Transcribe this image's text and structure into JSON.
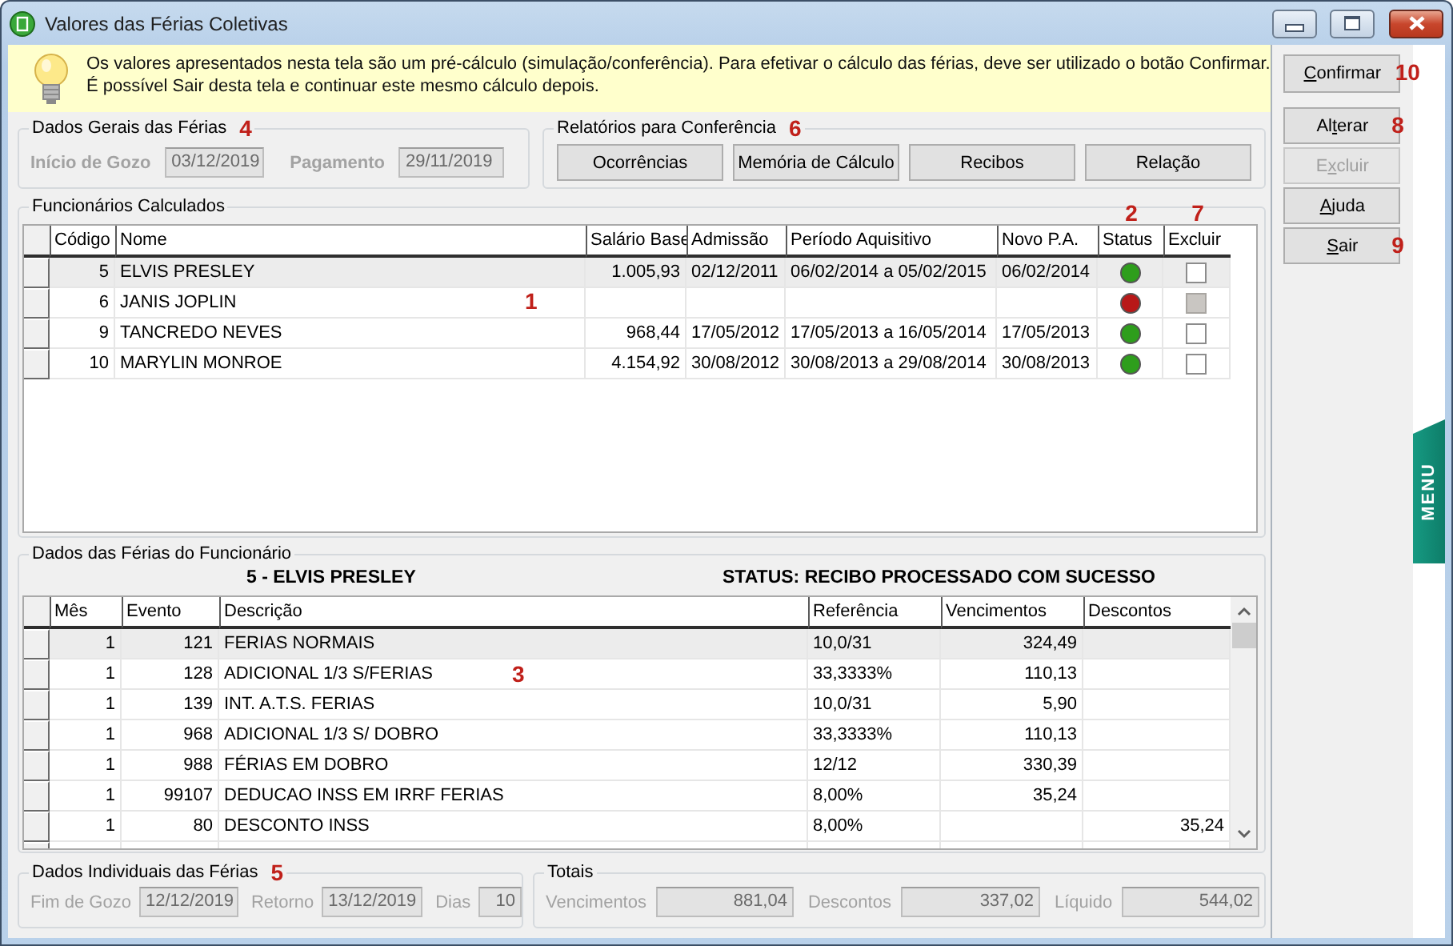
{
  "window": {
    "title": "Valores das Férias Coletivas"
  },
  "info_banner": {
    "lines": [
      "Os valores apresentados nesta tela são um pré-cálculo (simulação/conferência). Para efetivar o cálculo das férias, deve ser utilizado o botão Confirmar.",
      "É possível Sair desta tela e continuar este mesmo cálculo depois."
    ]
  },
  "general_group": {
    "title": "Dados Gerais das Férias",
    "marker": "4",
    "fields": [
      {
        "label": "Início de Gozo",
        "value": "03/12/2019"
      },
      {
        "label": "Pagamento",
        "value": "29/11/2019"
      }
    ]
  },
  "reports_group": {
    "title": "Relatórios para Conferência",
    "marker": "6",
    "buttons": [
      "Ocorrências",
      "Memória de Cálculo",
      "Recibos",
      "Relação"
    ]
  },
  "employees": {
    "title": "Funcionários Calculados",
    "marker": "1",
    "columns": [
      {
        "label": "Código"
      },
      {
        "label": "Nome"
      },
      {
        "label": "Salário Base"
      },
      {
        "label": "Admissão"
      },
      {
        "label": "Período Aquisitivo"
      },
      {
        "label": "Novo P.A."
      },
      {
        "label": "Status",
        "marker": "2"
      },
      {
        "label": "Excluir",
        "marker": "7"
      }
    ],
    "rows": [
      {
        "selected": true,
        "codigo": "5",
        "nome": "ELVIS PRESLEY",
        "salario_base": "1.005,93",
        "admissao": "02/12/2011",
        "periodo_aquisitivo": "06/02/2014 a 05/02/2015",
        "novo_pa": "06/02/2014",
        "color": "#2e9e1c",
        "excluir": {
          "checked": false,
          "disabled": false
        }
      },
      {
        "selected": false,
        "codigo": "6",
        "nome": "JANIS JOPLIN",
        "color": "#b81818",
        "excluir": {
          "checked": false,
          "disabled": true
        }
      },
      {
        "selected": false,
        "codigo": "9",
        "nome": "TANCREDO NEVES",
        "salario_base": "968,44",
        "admissao": "17/05/2012",
        "periodo_aquisitivo": "17/05/2013 a 16/05/2014",
        "novo_pa": "17/05/2013",
        "color": "#2e9e1c",
        "excluir": {
          "checked": false,
          "disabled": false
        }
      },
      {
        "selected": false,
        "codigo": "10",
        "nome": "MARYLIN MONROE",
        "salario_base": "4.154,92",
        "admissao": "30/08/2012",
        "periodo_aquisitivo": "30/08/2013 a 29/08/2014",
        "novo_pa": "30/08/2013",
        "color": "#2e9e1c",
        "excluir": {
          "checked": false,
          "disabled": false
        }
      }
    ]
  },
  "details": {
    "title": "Dados das Férias do Funcionário",
    "employee": "5 - ELVIS PRESLEY",
    "status": "STATUS: RECIBO PROCESSADO COM SUCESSO",
    "marker": "3",
    "columns": [
      "Mês",
      "Evento",
      "Descrição",
      "Referência",
      "Vencimentos",
      "Descontos"
    ],
    "rows": [
      {
        "selected": true,
        "mes": "1",
        "evento": "121",
        "descricao": "FERIAS NORMAIS",
        "referencia": "10,0/31",
        "vencimentos": "324,49"
      },
      {
        "selected": false,
        "mes": "1",
        "evento": "128",
        "descricao": "ADICIONAL 1/3 S/FERIAS",
        "referencia": "33,3333%",
        "vencimentos": "110,13"
      },
      {
        "selected": false,
        "mes": "1",
        "evento": "139",
        "descricao": "INT. A.T.S. FERIAS",
        "referencia": "10,0/31",
        "vencimentos": "5,90"
      },
      {
        "selected": false,
        "mes": "1",
        "evento": "968",
        "descricao": "ADICIONAL 1/3  S/ DOBRO",
        "referencia": "33,3333%",
        "vencimentos": "110,13"
      },
      {
        "selected": false,
        "mes": "1",
        "evento": "988",
        "descricao": "FÉRIAS EM DOBRO",
        "referencia": "12/12",
        "vencimentos": "330,39"
      },
      {
        "selected": false,
        "mes": "1",
        "evento": "99107",
        "descricao": "DEDUCAO INSS EM IRRF FERIAS",
        "referencia": "8,00%",
        "vencimentos": "35,24"
      },
      {
        "selected": false,
        "mes": "1",
        "evento": "80",
        "descricao": "DESCONTO INSS",
        "referencia": "8,00%",
        "descontos": "35,24"
      }
    ]
  },
  "individual_group": {
    "title": "Dados Individuais das Férias",
    "marker": "5",
    "fields": [
      {
        "label": "Fim de Gozo",
        "value": "12/12/2019"
      },
      {
        "label": "Retorno",
        "value": "13/12/2019"
      },
      {
        "label": "Dias",
        "value": "10"
      }
    ]
  },
  "totals_group": {
    "title": "Totais",
    "fields": [
      {
        "label": "Vencimentos",
        "value": "881,04"
      },
      {
        "label": "Descontos",
        "value": "337,02"
      },
      {
        "label": "Líquido",
        "value": "544,02"
      }
    ]
  },
  "side_buttons": [
    {
      "key": "C",
      "after": "onfirmar",
      "disabled": false,
      "marker": "10"
    },
    {
      "before": "Al",
      "key": "t",
      "after": "erar",
      "disabled": false,
      "marker": "8"
    },
    {
      "before": "E",
      "key": "x",
      "after": "cluir",
      "disabled": true
    },
    {
      "key": "A",
      "after": "juda",
      "disabled": false
    },
    {
      "key": "S",
      "after": "air",
      "disabled": false,
      "marker": "9"
    }
  ],
  "menu_tab": {
    "label": "MENU"
  }
}
